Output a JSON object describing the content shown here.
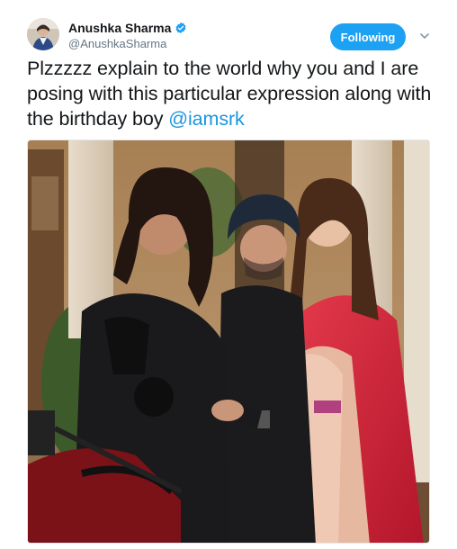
{
  "author": {
    "display_name": "Anushka Sharma",
    "handle": "@AnushkaSharma",
    "verified": true,
    "verified_icon": "verified-badge-icon",
    "avatar_icon": "profile-avatar"
  },
  "follow_button": {
    "label": "Following"
  },
  "menu": {
    "icon": "chevron-down-icon"
  },
  "tweet": {
    "text_before_mention": "Plzzzzz explain to the world why you and I are posing with this particular expression along with the birthday boy ",
    "mention": "@iamsrk"
  },
  "media": {
    "type": "photo",
    "description_icon": "photo-of-three-people-with-motorcycle"
  },
  "colors": {
    "brand_blue": "#1da1f2",
    "link_blue": "#1b95e0",
    "secondary_text": "#657786"
  }
}
